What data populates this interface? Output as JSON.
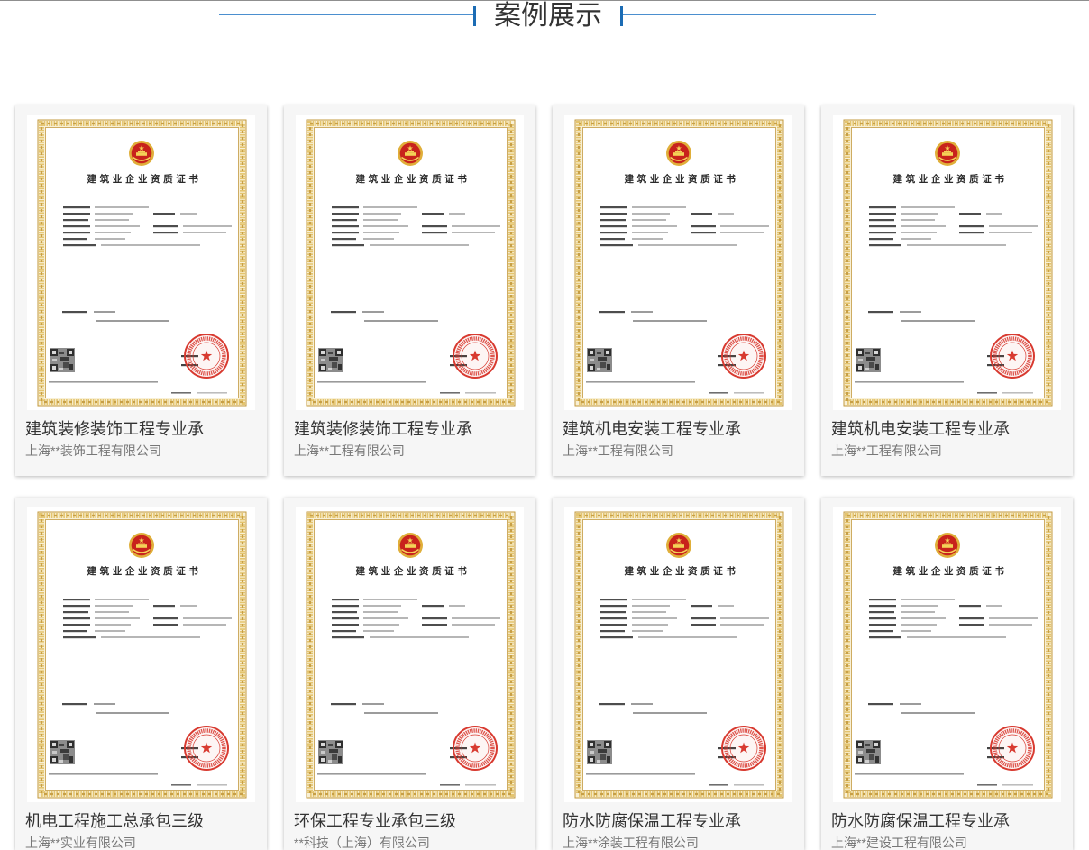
{
  "section": {
    "title": "案例展示"
  },
  "certificate": {
    "title": "建筑业企业资质证书",
    "emblem_icon": "national-emblem-icon",
    "seal_icon": "official-seal-icon",
    "qr_icon": "qr-code-icon"
  },
  "cases": [
    {
      "title": "建筑装修装饰工程专业承",
      "company": "上海**装饰工程有限公司"
    },
    {
      "title": "建筑装修装饰工程专业承",
      "company": "上海**工程有限公司"
    },
    {
      "title": "建筑机电安装工程专业承",
      "company": "上海**工程有限公司"
    },
    {
      "title": "建筑机电安装工程专业承",
      "company": "上海**工程有限公司"
    },
    {
      "title": "机电工程施工总承包三级",
      "company": "上海**实业有限公司"
    },
    {
      "title": "环保工程专业承包三级",
      "company": "**科技（上海）有限公司"
    },
    {
      "title": "防水防腐保温工程专业承",
      "company": "上海**涂装工程有限公司"
    },
    {
      "title": "防水防腐保温工程专业承",
      "company": "上海**建设工程有限公司"
    }
  ],
  "theme": {
    "accent": "#1c6cb4",
    "line": "#4b8fcf",
    "seal": "#d83a30",
    "frame_gold": "#e4c46e"
  }
}
